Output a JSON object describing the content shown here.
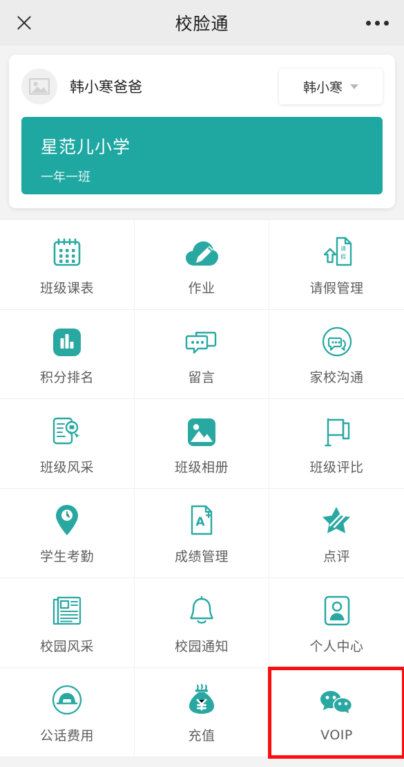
{
  "header": {
    "title": "校脸通",
    "close_icon": "close-icon",
    "menu_icon": "more-dots-icon"
  },
  "profile": {
    "avatar_icon": "image-placeholder-icon",
    "parent_name": "韩小寒爸爸",
    "student_selector": {
      "value": "韩小寒",
      "caret_icon": "chevron-down-icon"
    },
    "school": {
      "name": "星范儿小学",
      "class": "一年一班",
      "background_color": "#1fa8a2"
    }
  },
  "accent_color": "#1fa8a2",
  "highlight_color": "#fd0d0d",
  "grid": {
    "items": [
      {
        "label": "班级课表",
        "icon": "calendar-icon"
      },
      {
        "label": "作业",
        "icon": "cloud-pencil-icon"
      },
      {
        "label": "请假管理",
        "icon": "leave-request-document-icon"
      },
      {
        "label": "积分排名",
        "icon": "bar-chart-icon"
      },
      {
        "label": "留言",
        "icon": "message-bubbles-icon"
      },
      {
        "label": "家校沟通",
        "icon": "chat-circle-icon"
      },
      {
        "label": "班级风采",
        "icon": "certificate-icon"
      },
      {
        "label": "班级相册",
        "icon": "photo-icon"
      },
      {
        "label": "班级评比",
        "icon": "flag-icon"
      },
      {
        "label": "学生考勤",
        "icon": "location-clock-pin-icon"
      },
      {
        "label": "成绩管理",
        "icon": "grade-a-plus-icon"
      },
      {
        "label": "点评",
        "icon": "star-pen-icon"
      },
      {
        "label": "校园风采",
        "icon": "newspaper-icon"
      },
      {
        "label": "校园通知",
        "icon": "bell-icon"
      },
      {
        "label": "个人中心",
        "icon": "person-card-icon"
      },
      {
        "label": "公话费用",
        "icon": "telephone-circle-icon"
      },
      {
        "label": "充值",
        "icon": "money-bag-yuan-icon"
      },
      {
        "label": "VOIP",
        "icon": "wechat-bubbles-icon",
        "highlighted": true
      }
    ]
  }
}
